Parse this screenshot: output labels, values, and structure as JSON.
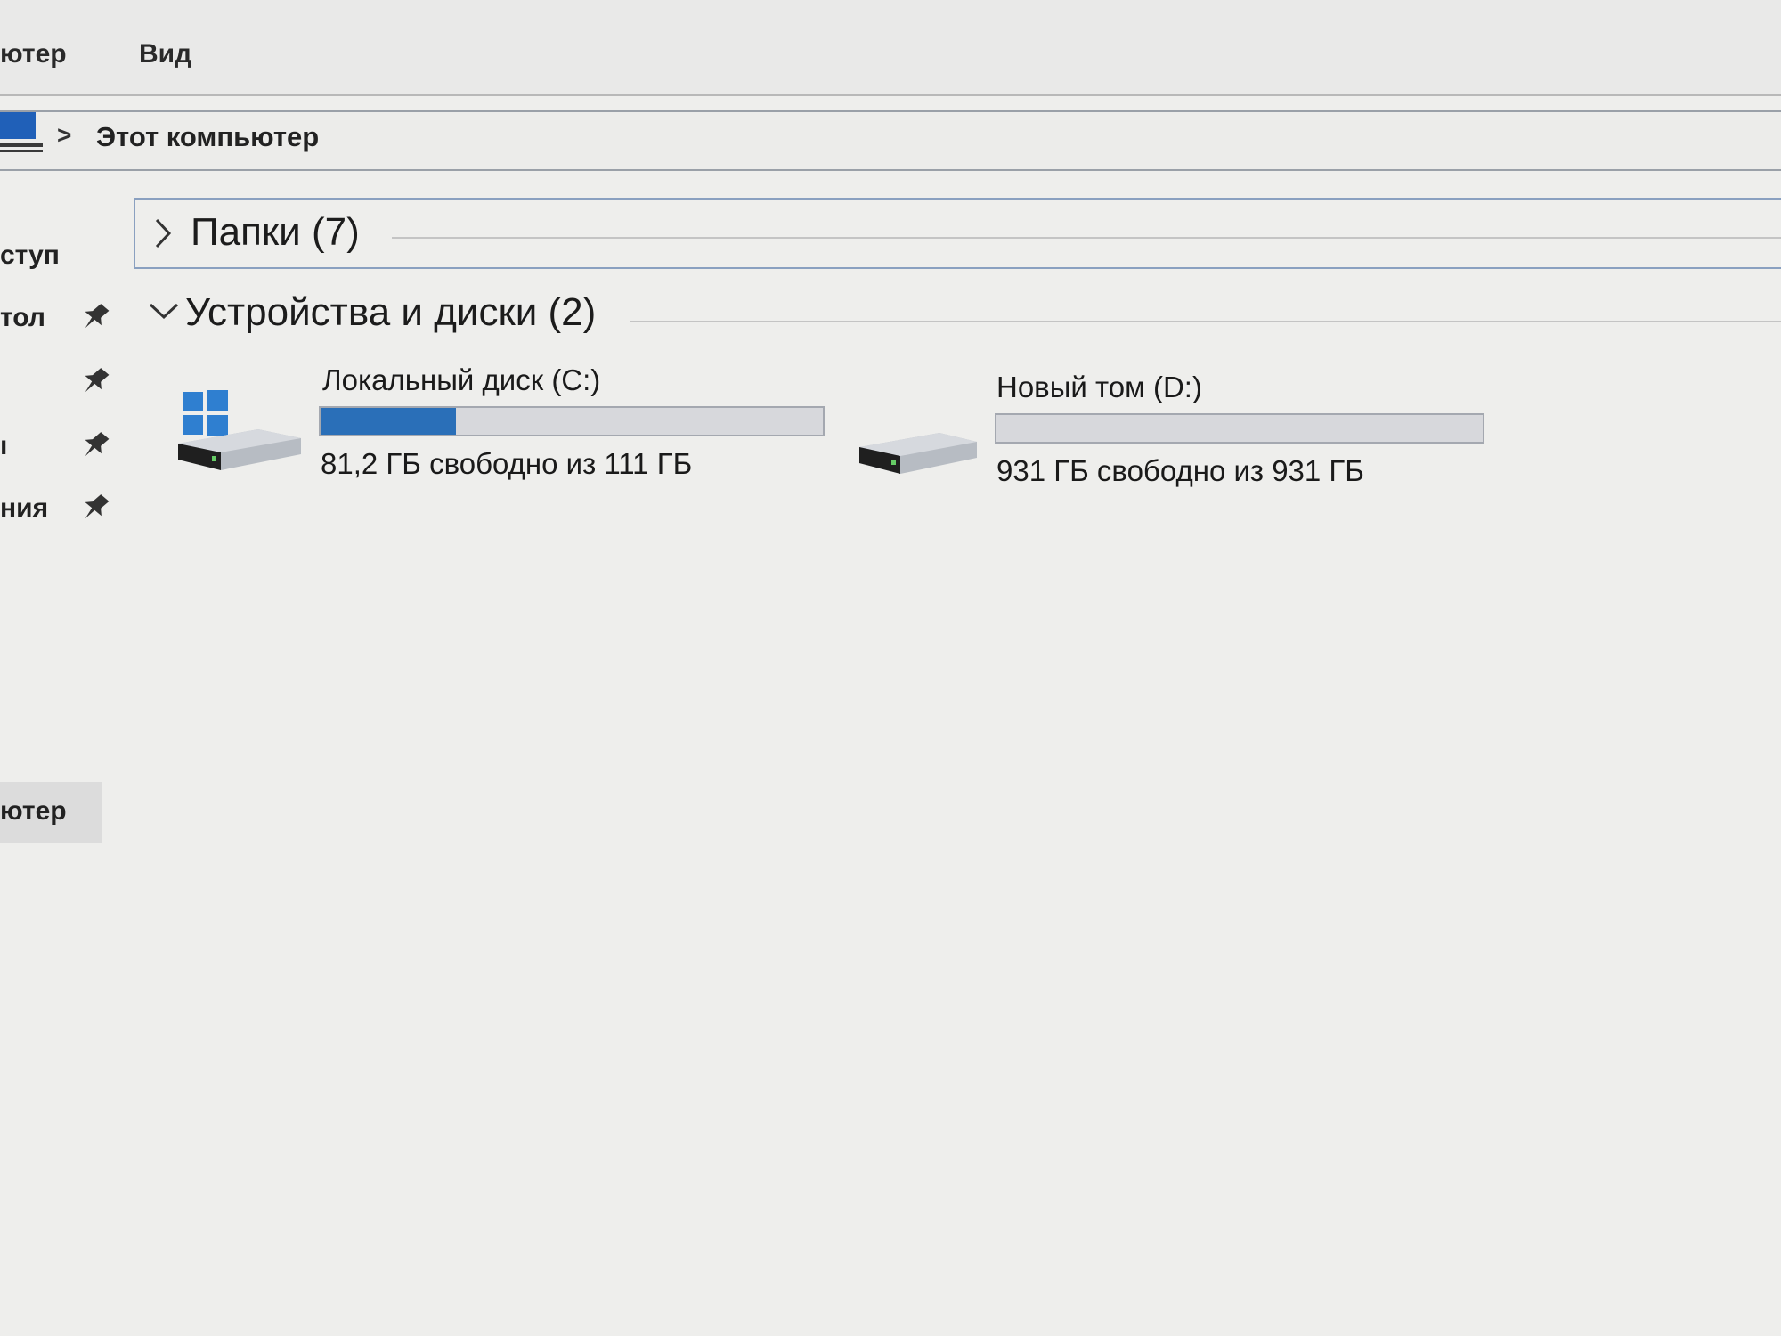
{
  "ribbon": {
    "tabs": [
      "ютер",
      "Вид"
    ]
  },
  "address": {
    "separator": ">",
    "location": "Этот компьютер"
  },
  "sidebar": {
    "items": [
      {
        "label": "ступ",
        "pinned": false
      },
      {
        "label": "тол",
        "pinned": true
      },
      {
        "label": "",
        "pinned": true
      },
      {
        "label": "ı",
        "pinned": true
      },
      {
        "label": "ния",
        "pinned": true
      },
      {
        "label": "ютер",
        "pinned": false,
        "selected": true
      }
    ]
  },
  "sections": {
    "folders": {
      "title": "Папки (7)",
      "expanded": false
    },
    "devices": {
      "title": "Устройства и диски (2)",
      "expanded": true
    }
  },
  "drives": [
    {
      "name": "Локальный диск (C:)",
      "free_text": "81,2 ГБ свободно из 111 ГБ",
      "used_fraction": 0.27,
      "system": true
    },
    {
      "name": "Новый том (D:)",
      "free_text": "931 ГБ свободно из 931 ГБ",
      "used_fraction": 0.0,
      "system": false
    }
  ],
  "colors": {
    "usage_bar": "#2a6fb8",
    "windows_logo": "#2f7fd0"
  }
}
